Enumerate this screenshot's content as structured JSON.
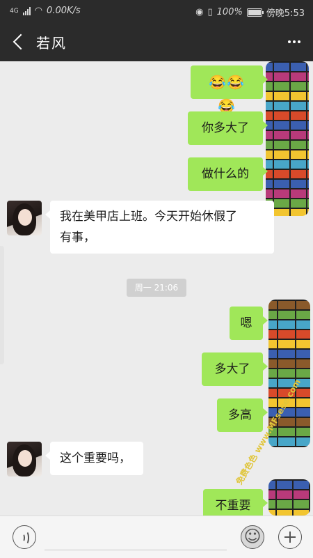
{
  "status_bar": {
    "network": "4G",
    "speed": "0.00K/s",
    "battery": "100%",
    "time": "傍晚5:53"
  },
  "header": {
    "title": "若风"
  },
  "messages": [
    {
      "side": "out",
      "text": "😂😂😂"
    },
    {
      "side": "out",
      "text": "你多大了"
    },
    {
      "side": "out",
      "text": "做什么的"
    },
    {
      "side": "in",
      "line1": "我在美甲店上班。今天开始休假了",
      "line2": "有事，"
    },
    {
      "side": "out",
      "text": "嗯"
    },
    {
      "side": "out",
      "text": "多大了"
    },
    {
      "side": "out",
      "text": "多高"
    },
    {
      "side": "in",
      "text": "这个重要吗，"
    },
    {
      "side": "out",
      "text": "不重要"
    }
  ],
  "timestamp": "周一 21:06",
  "watermark": "免费色色 www.MFsese.com",
  "colors": {
    "header_bg": "#2b2b2b",
    "outgoing_bubble": "#a0e759",
    "incoming_bubble": "#ffffff",
    "chat_bg": "#ececec"
  },
  "icons": {
    "back": "back-chevron-icon",
    "more": "more-dots-icon",
    "voice": "voice-icon",
    "emoji": "emoji-icon",
    "plus": "plus-icon"
  }
}
